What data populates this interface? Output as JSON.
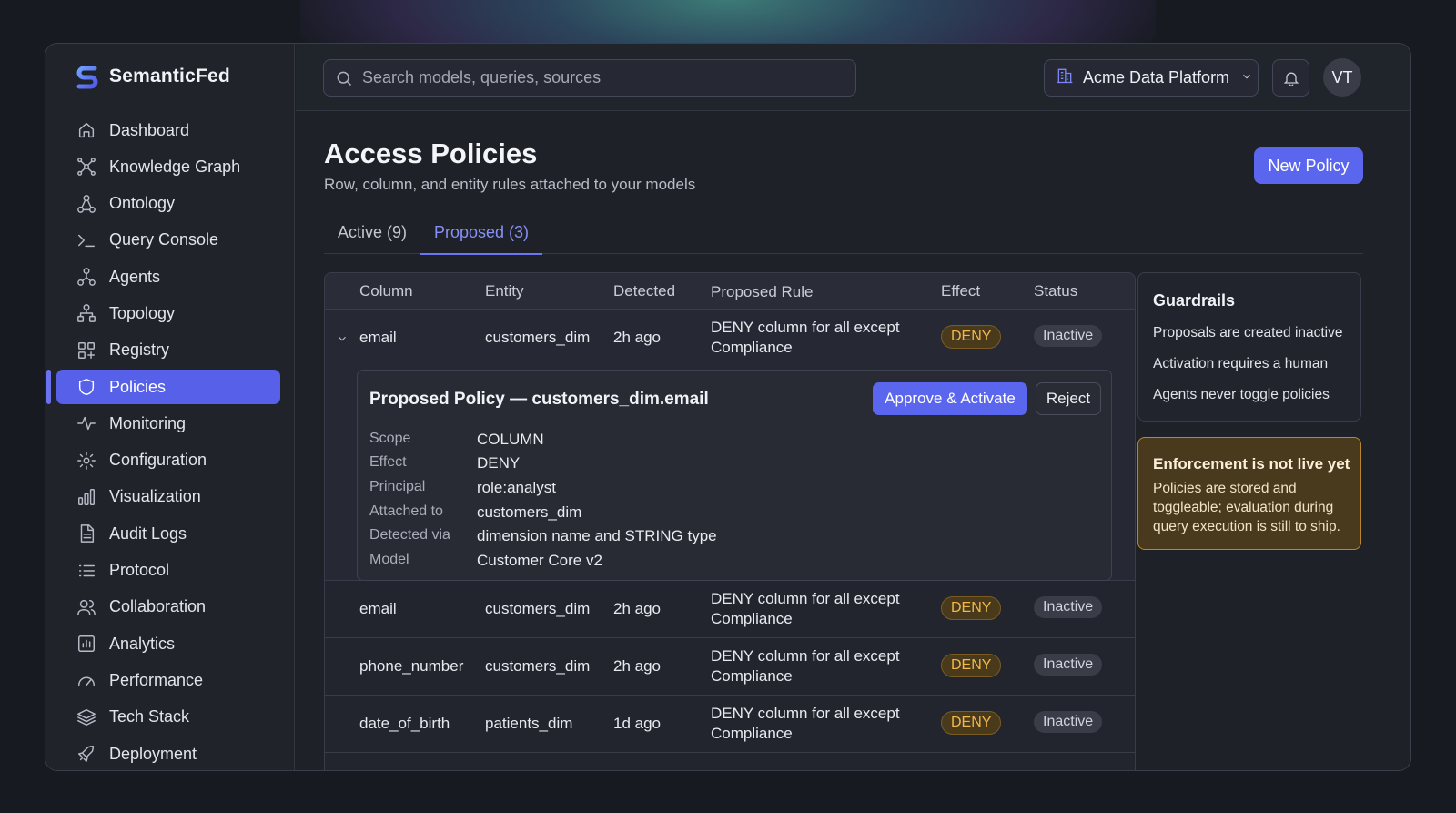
{
  "brand": {
    "name": "SemanticFed"
  },
  "sidebar": {
    "items": [
      {
        "label": "Dashboard",
        "icon": "home-icon"
      },
      {
        "label": "Knowledge Graph",
        "icon": "graph-icon"
      },
      {
        "label": "Ontology",
        "icon": "ontology-icon"
      },
      {
        "label": "Query Console",
        "icon": "terminal-icon"
      },
      {
        "label": "Agents",
        "icon": "agents-icon"
      },
      {
        "label": "Topology",
        "icon": "topology-icon"
      },
      {
        "label": "Registry",
        "icon": "registry-icon"
      },
      {
        "label": "Policies",
        "icon": "shield-icon",
        "active": true
      },
      {
        "label": "Monitoring",
        "icon": "pulse-icon"
      },
      {
        "label": "Configuration",
        "icon": "gear-icon"
      },
      {
        "label": "Visualization",
        "icon": "bar-chart-icon"
      },
      {
        "label": "Audit Logs",
        "icon": "document-icon"
      },
      {
        "label": "Protocol",
        "icon": "list-icon"
      },
      {
        "label": "Collaboration",
        "icon": "users-icon"
      },
      {
        "label": "Analytics",
        "icon": "analytics-icon"
      },
      {
        "label": "Performance",
        "icon": "gauge-icon"
      },
      {
        "label": "Tech Stack",
        "icon": "layers-icon"
      },
      {
        "label": "Deployment",
        "icon": "rocket-icon"
      }
    ]
  },
  "topbar": {
    "search_placeholder": "Search models, queries, sources",
    "org_name": "Acme Data Platform",
    "avatar_initials": "VT"
  },
  "page": {
    "title": "Access Policies",
    "subtitle": "Row, column, and entity rules attached to your models",
    "new_policy_label": "New Policy",
    "tabs": [
      {
        "label": "Active (9)"
      },
      {
        "label": "Proposed (3)",
        "selected": true
      }
    ]
  },
  "table": {
    "headers": [
      "Column",
      "Entity",
      "Detected",
      "Proposed Rule",
      "Effect",
      "Status"
    ],
    "rows": [
      {
        "column": "email",
        "entity": "customers_dim",
        "detected": "2h ago",
        "rule_line1": "DENY column for all except",
        "rule_line2": "Compliance",
        "effect": "DENY",
        "status": "Inactive",
        "expanded": true
      },
      {
        "column": "email",
        "entity": "customers_dim",
        "detected": "2h ago",
        "rule_line1": "DENY column for all except",
        "rule_line2": "Compliance",
        "effect": "DENY",
        "status": "Inactive"
      },
      {
        "column": "phone_number",
        "entity": "customers_dim",
        "detected": "2h ago",
        "rule_line1": "DENY column for all except",
        "rule_line2": "Compliance",
        "effect": "DENY",
        "status": "Inactive"
      },
      {
        "column": "date_of_birth",
        "entity": "patients_dim",
        "detected": "1d ago",
        "rule_line1": "DENY column for all except",
        "rule_line2": "Compliance",
        "effect": "DENY",
        "status": "Inactive"
      }
    ]
  },
  "detail": {
    "title": "Proposed Policy — customers_dim.email",
    "approve_label": "Approve & Activate",
    "reject_label": "Reject",
    "fields": [
      {
        "key": "Scope",
        "value": "COLUMN"
      },
      {
        "key": "Effect",
        "value": "DENY"
      },
      {
        "key": "Principal",
        "value": "role:analyst"
      },
      {
        "key": "Attached to",
        "value": "customers_dim"
      },
      {
        "key": "Detected via",
        "value": "dimension name and STRING type"
      },
      {
        "key": "Model",
        "value": "Customer Core v2"
      }
    ]
  },
  "guardrails": {
    "title": "Guardrails",
    "items": [
      "Proposals are created inactive",
      "Activation requires a human",
      "Agents never toggle policies"
    ]
  },
  "warning": {
    "title": "Enforcement is not live yet",
    "text": "Policies are stored and toggleable; evaluation during query execution is still to ship."
  },
  "colors": {
    "accent": "#5b66ee",
    "deny_text": "#f2b84b",
    "warning_border": "#b9862f",
    "background": "#181a22"
  }
}
